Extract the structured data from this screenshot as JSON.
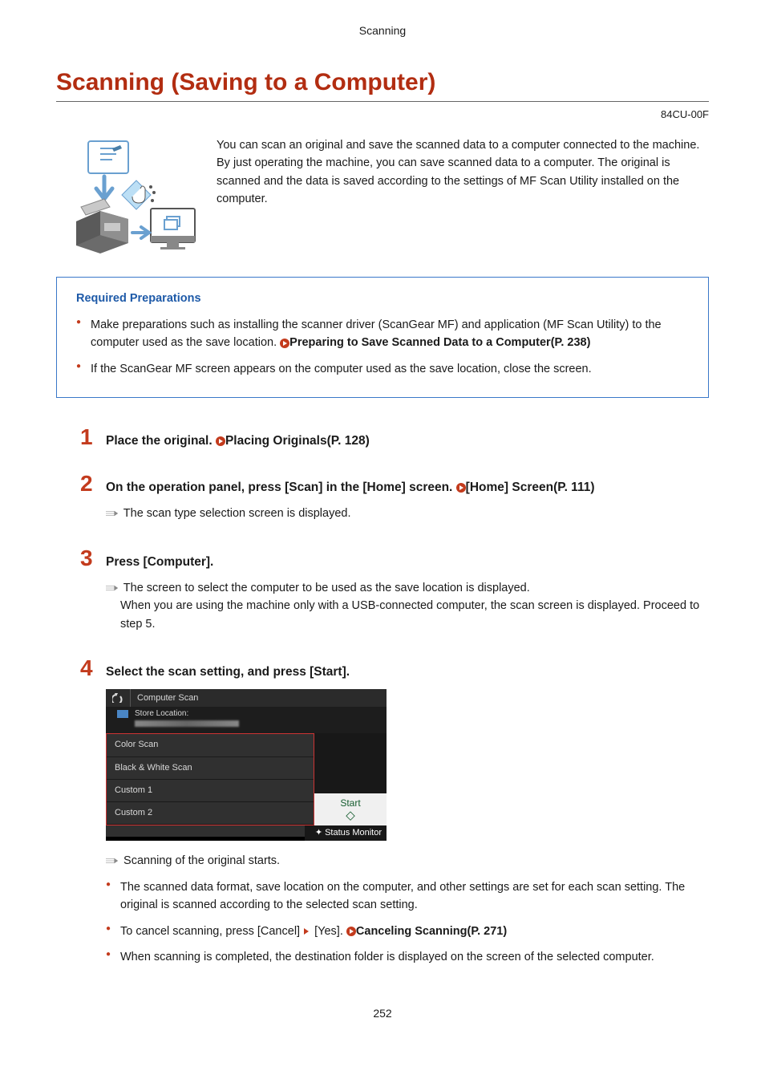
{
  "header": {
    "section": "Scanning",
    "page_number": "252"
  },
  "title": "Scanning (Saving to a Computer)",
  "doc_id": "84CU-00F",
  "intro": "You can scan an original and save the scanned data to a computer connected to the machine. By just operating the machine, you can save scanned data to a computer. The original is scanned and the data is saved according to the settings of MF Scan Utility installed on the computer.",
  "required": {
    "title": "Required Preparations",
    "items": [
      {
        "text": "Make preparations such as installing the scanner driver (ScanGear MF) and application (MF Scan Utility) to the computer used as the save location. ",
        "link": "Preparing to Save Scanned Data to a Computer(P. 238)"
      },
      {
        "text": "If the ScanGear MF screen appears on the computer used as the save location, close the screen.",
        "link": ""
      }
    ]
  },
  "steps": [
    {
      "num": "1",
      "title_pre": "Place the original. ",
      "link": "Placing Originals(P. 128)",
      "title_post": ""
    },
    {
      "num": "2",
      "title_pre": "On the operation panel, press [Scan] in the [Home] screen. ",
      "link": "[Home] Screen(P. 111)",
      "title_post": "",
      "result": "The scan type selection screen is displayed."
    },
    {
      "num": "3",
      "title_pre": "Press [Computer].",
      "link": "",
      "title_post": "",
      "result_lines": [
        "The screen to select the computer to be used as the save location is displayed.",
        "When you are using the machine only with a USB-connected computer, the scan screen is displayed. Proceed to step 5."
      ]
    },
    {
      "num": "4",
      "title_pre": "Select the scan setting, and press [Start].",
      "link": "",
      "title_post": "",
      "ui": {
        "top_title": "Computer Scan",
        "store_label": "Store Location:",
        "items": [
          "Color Scan",
          "Black & White Scan",
          "Custom 1",
          "Custom 2"
        ],
        "start": "Start",
        "status": "Status Monitor"
      },
      "result": "Scanning of the original starts.",
      "bullets": [
        {
          "text": "The scanned data format, save location on the computer, and other settings are set for each scan setting. The original is scanned according to the selected scan setting.",
          "link": ""
        },
        {
          "pre": "To cancel scanning, press [Cancel] ",
          "mid": " [Yes]. ",
          "link": "Canceling Scanning(P. 271)"
        },
        {
          "text": "When scanning is completed, the destination folder is displayed on the screen of the selected computer.",
          "link": ""
        }
      ]
    }
  ]
}
